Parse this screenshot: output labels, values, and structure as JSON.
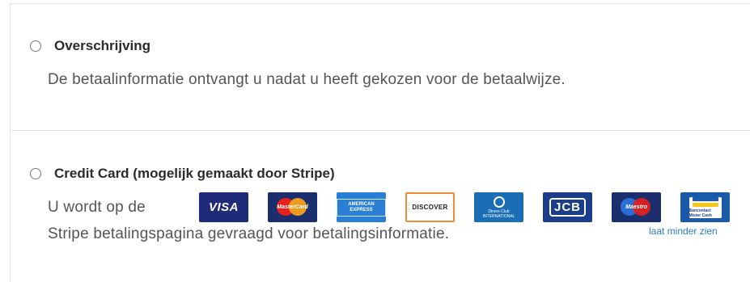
{
  "payment_options": [
    {
      "label": "Overschrijving",
      "description": "De betaalinformatie ontvangt u nadat u heeft gekozen voor de betaalwijze.",
      "selected": false
    },
    {
      "label": "Credit Card (mogelijk gemaakt door Stripe)",
      "description_line1": "U wordt op de",
      "description_line2": "Stripe betalingspagina gevraagd voor betalingsinformatie.",
      "selected": false
    }
  ],
  "card_logos": [
    {
      "icon": "visa-icon",
      "text": "VISA",
      "color": "#1f2a7a"
    },
    {
      "icon": "mastercard-icon",
      "text": "MasterCard",
      "color": "#1b2f6e"
    },
    {
      "icon": "american-express-icon",
      "text": "AMERICAN EXPRESS",
      "color": "#2a7fd4"
    },
    {
      "icon": "discover-icon",
      "text": "DISCOVER",
      "color": "#f08a33"
    },
    {
      "icon": "diners-club-icon",
      "text": "Diners Club INTERNATIONAL",
      "color": "#1b6eb6"
    },
    {
      "icon": "jcb-icon",
      "text": "JCB",
      "color": "#1b3e8a"
    },
    {
      "icon": "maestro-icon",
      "text": "Maestro",
      "color": "#1b2f6e"
    },
    {
      "icon": "bancontact-icon",
      "text": "Bancontact Mister Cash",
      "color": "#1b5aa8"
    }
  ],
  "show_less_link": "laat minder zien",
  "colors": {
    "border": "#e3e3e3",
    "text_primary": "#2b2b2b",
    "text_secondary": "#555555",
    "link": "#2a7dc5"
  }
}
